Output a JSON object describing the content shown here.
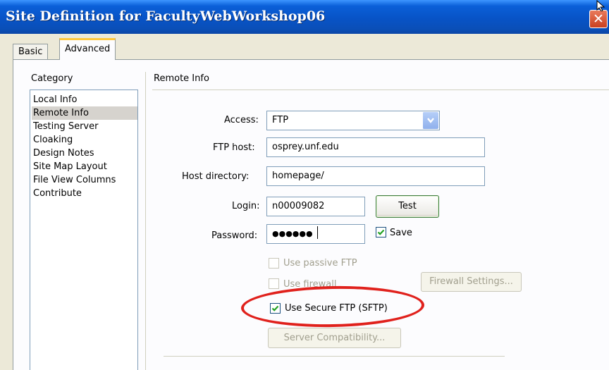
{
  "window": {
    "title": "Site Definition for FacultyWebWorkshop06",
    "close_glyph": "✕"
  },
  "tabs": [
    {
      "label": "Basic",
      "active": false
    },
    {
      "label": "Advanced",
      "active": true
    }
  ],
  "category": {
    "heading": "Category",
    "items": [
      "Local Info",
      "Remote Info",
      "Testing Server",
      "Cloaking",
      "Design Notes",
      "Site Map Layout",
      "File View Columns",
      "Contribute"
    ],
    "selected": "Remote Info"
  },
  "remote": {
    "heading": "Remote Info",
    "access_label": "Access:",
    "access_value": "FTP",
    "ftp_host_label": "FTP host:",
    "ftp_host_value": "osprey.unf.edu",
    "host_dir_label": "Host directory:",
    "host_dir_value": "homepage/",
    "login_label": "Login:",
    "login_value": "n00009082",
    "test_button": "Test",
    "password_label": "Password:",
    "password_mask": "●●●●●●",
    "save_label": "Save",
    "save_checked": true,
    "passive_ftp_label": "Use passive FTP",
    "passive_ftp_checked": false,
    "use_firewall_label": "Use firewall",
    "use_firewall_checked": false,
    "firewall_button": "Firewall Settings...",
    "secure_ftp_label": "Use Secure FTP (SFTP)",
    "secure_ftp_checked": true,
    "server_compat_button": "Server Compatibility..."
  },
  "colors": {
    "titlebar": "#0853c6",
    "highlight_ellipse": "#e0211c",
    "tab_accent": "#ffc83c"
  },
  "icons": {
    "close": "close-icon",
    "dropdown": "chevron-down-icon",
    "check": "check-icon",
    "cursor": "mouse-pointer-icon"
  }
}
